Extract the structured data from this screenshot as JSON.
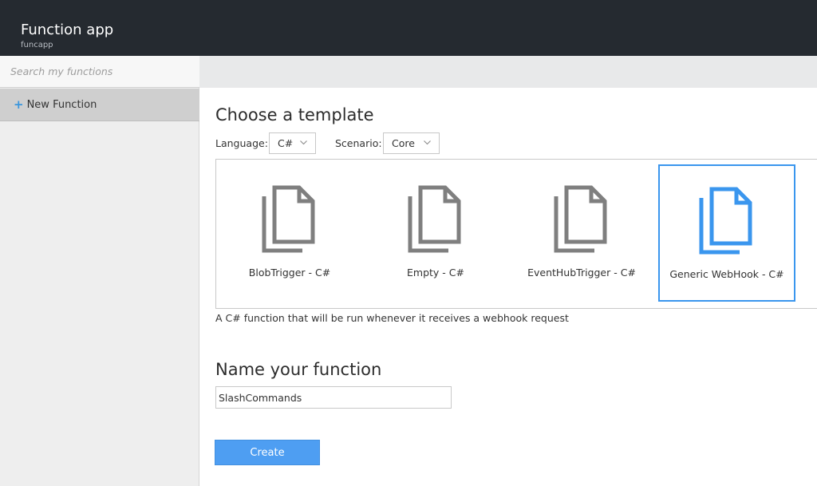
{
  "header": {
    "title": "Function app",
    "subtitle": "funcapp"
  },
  "sidebar": {
    "search_placeholder": "Search my functions",
    "new_function_label": "New Function"
  },
  "main": {
    "heading": "Choose a template",
    "language_label": "Language:",
    "language_value": "C#",
    "scenario_label": "Scenario:",
    "scenario_value": "Core",
    "templates": [
      {
        "name": "BlobTrigger - C#",
        "selected": false
      },
      {
        "name": "Empty - C#",
        "selected": false
      },
      {
        "name": "EventHubTrigger - C#",
        "selected": false
      },
      {
        "name": "Generic WebHook - C#",
        "selected": true
      }
    ],
    "template_description": "A C# function that will be run whenever it receives a webhook request",
    "name_heading": "Name your function",
    "name_value": "SlashCommands",
    "create_label": "Create"
  },
  "icons": {
    "new": "plus-icon",
    "template": "document-icon",
    "dropdown": "chevron-down-icon"
  },
  "colors": {
    "topbar": "#252a30",
    "accent": "#3a96ee",
    "button": "#4e9ef2",
    "icon_gray": "#7f7f7f",
    "icon_selected": "#3a96ee"
  }
}
